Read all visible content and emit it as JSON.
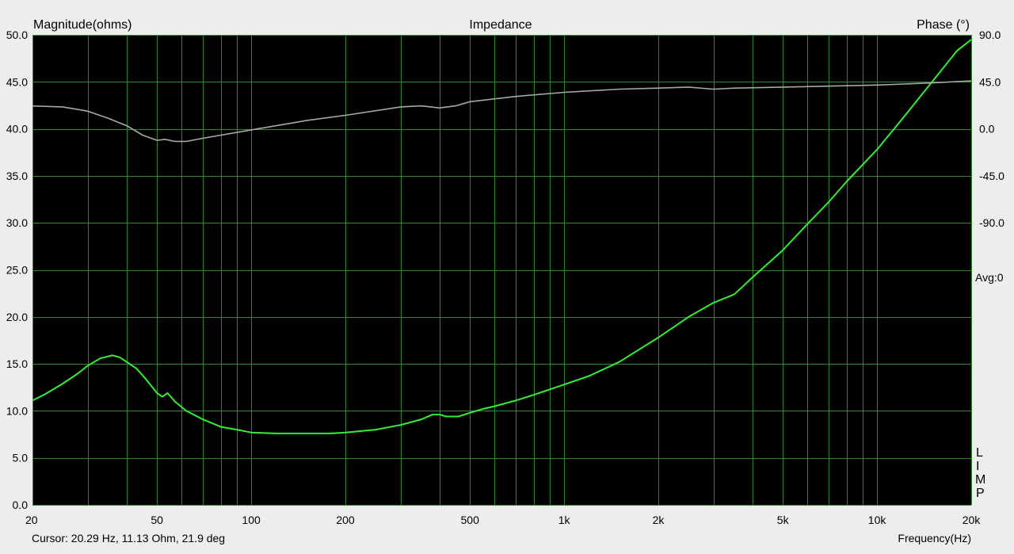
{
  "chart_data": {
    "type": "line",
    "title": "Impedance",
    "ylabel": "Magnitude(ohms)",
    "y2label": "Phase (°)",
    "xlabel": "Frequency(Hz)",
    "x_scale": "log",
    "xlim": [
      20,
      20000
    ],
    "ylim": [
      0,
      50
    ],
    "y2lim": [
      -360,
      90
    ],
    "grid": true,
    "x_ticks": [
      {
        "value": 20,
        "label": "20"
      },
      {
        "value": 50,
        "label": "50"
      },
      {
        "value": 100,
        "label": "100"
      },
      {
        "value": 200,
        "label": "200"
      },
      {
        "value": 500,
        "label": "500"
      },
      {
        "value": 1000,
        "label": "1k"
      },
      {
        "value": 2000,
        "label": "2k"
      },
      {
        "value": 5000,
        "label": "5k"
      },
      {
        "value": 10000,
        "label": "10k"
      },
      {
        "value": 20000,
        "label": "20k"
      }
    ],
    "y_ticks": [
      {
        "value": 0,
        "label": "0.0"
      },
      {
        "value": 5,
        "label": "5.0"
      },
      {
        "value": 10,
        "label": "10.0"
      },
      {
        "value": 15,
        "label": "15.0"
      },
      {
        "value": 20,
        "label": "20.0"
      },
      {
        "value": 25,
        "label": "25.0"
      },
      {
        "value": 30,
        "label": "30.0"
      },
      {
        "value": 35,
        "label": "35.0"
      },
      {
        "value": 40,
        "label": "40.0"
      },
      {
        "value": 45,
        "label": "45.0"
      },
      {
        "value": 50,
        "label": "50.0"
      }
    ],
    "y2_ticks": [
      {
        "value": 90,
        "label": "90.0"
      },
      {
        "value": 45,
        "label": "45.0"
      },
      {
        "value": 0,
        "label": "0.0"
      },
      {
        "value": -45,
        "label": "-45.0"
      },
      {
        "value": -90,
        "label": "-90.0"
      }
    ],
    "series": [
      {
        "role": "magnitude",
        "axis": "left",
        "color": "#33ee33",
        "points": [
          [
            20,
            11.1
          ],
          [
            22,
            11.8
          ],
          [
            25,
            12.9
          ],
          [
            28,
            14.0
          ],
          [
            30,
            14.8
          ],
          [
            33,
            15.6
          ],
          [
            36,
            15.9
          ],
          [
            38,
            15.7
          ],
          [
            40,
            15.2
          ],
          [
            43,
            14.5
          ],
          [
            46,
            13.4
          ],
          [
            50,
            11.9
          ],
          [
            52,
            11.5
          ],
          [
            54,
            11.9
          ],
          [
            57,
            11.0
          ],
          [
            62,
            10.0
          ],
          [
            70,
            9.1
          ],
          [
            80,
            8.3
          ],
          [
            90,
            8.0
          ],
          [
            100,
            7.7
          ],
          [
            120,
            7.6
          ],
          [
            150,
            7.6
          ],
          [
            180,
            7.6
          ],
          [
            200,
            7.7
          ],
          [
            250,
            8.0
          ],
          [
            300,
            8.5
          ],
          [
            350,
            9.1
          ],
          [
            380,
            9.6
          ],
          [
            400,
            9.6
          ],
          [
            420,
            9.4
          ],
          [
            460,
            9.4
          ],
          [
            500,
            9.8
          ],
          [
            550,
            10.2
          ],
          [
            600,
            10.5
          ],
          [
            700,
            11.1
          ],
          [
            800,
            11.7
          ],
          [
            1000,
            12.8
          ],
          [
            1200,
            13.7
          ],
          [
            1500,
            15.2
          ],
          [
            2000,
            17.8
          ],
          [
            2500,
            20.0
          ],
          [
            3000,
            21.5
          ],
          [
            3500,
            22.4
          ],
          [
            4000,
            24.2
          ],
          [
            5000,
            27.1
          ],
          [
            6000,
            29.9
          ],
          [
            7000,
            32.2
          ],
          [
            8000,
            34.4
          ],
          [
            10000,
            37.8
          ],
          [
            12000,
            41.0
          ],
          [
            15000,
            45.0
          ],
          [
            18000,
            48.3
          ],
          [
            20000,
            49.5
          ]
        ]
      },
      {
        "role": "phase",
        "axis": "right",
        "color": "#a8a8a8",
        "points": [
          [
            20,
            21.9
          ],
          [
            25,
            21.0
          ],
          [
            30,
            17.0
          ],
          [
            35,
            10.0
          ],
          [
            40,
            3.0
          ],
          [
            45,
            -6.0
          ],
          [
            50,
            -11.0
          ],
          [
            53,
            -10.0
          ],
          [
            57,
            -12.0
          ],
          [
            62,
            -12.0
          ],
          [
            70,
            -9.0
          ],
          [
            80,
            -6.0
          ],
          [
            100,
            -1.0
          ],
          [
            150,
            8.0
          ],
          [
            200,
            13.0
          ],
          [
            300,
            21.0
          ],
          [
            350,
            22.0
          ],
          [
            400,
            20.0
          ],
          [
            450,
            22.0
          ],
          [
            500,
            26.0
          ],
          [
            700,
            31.0
          ],
          [
            1000,
            35.0
          ],
          [
            1500,
            38.0
          ],
          [
            2000,
            39.0
          ],
          [
            2500,
            40.0
          ],
          [
            3000,
            38.0
          ],
          [
            3500,
            39.0
          ],
          [
            5000,
            40.0
          ],
          [
            10000,
            42.0
          ],
          [
            15000,
            44.0
          ],
          [
            20000,
            46.0
          ]
        ]
      }
    ],
    "side_labels": {
      "avg": "Avg:0",
      "limp": [
        "L",
        "I",
        "M",
        "P"
      ]
    }
  },
  "status": {
    "cursor": "Cursor: 20.29 Hz, 11.13 Ohm, 21.9 deg"
  }
}
